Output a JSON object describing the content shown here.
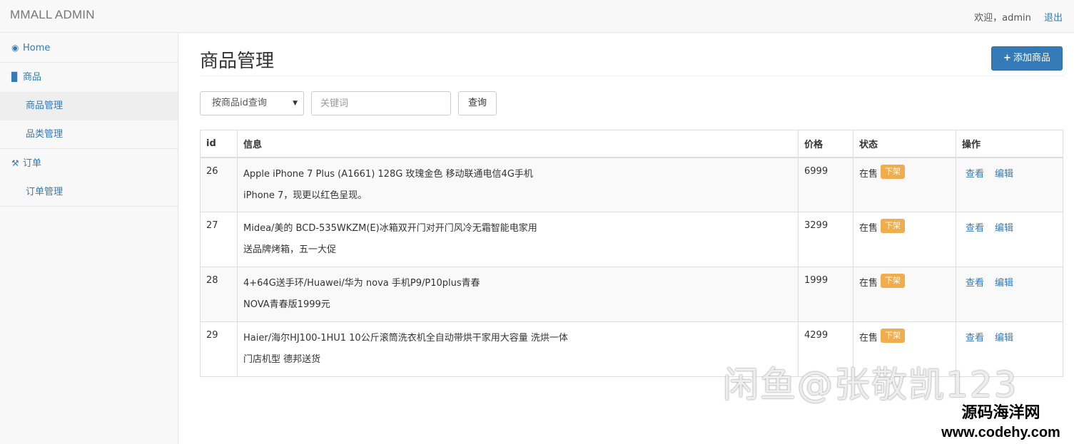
{
  "app": {
    "brand": "MMALL ADMIN"
  },
  "header": {
    "welcome": "欢迎，admin",
    "logout": "退出"
  },
  "sidebar": {
    "items": [
      {
        "label": "Home",
        "icon": "dashboard-icon"
      },
      {
        "label": "商品",
        "icon": "bar-chart-icon"
      },
      {
        "label": "商品管理"
      },
      {
        "label": "品类管理"
      },
      {
        "label": "订单",
        "icon": "wrench-icon"
      },
      {
        "label": "订单管理"
      }
    ]
  },
  "main": {
    "title": "商品管理",
    "add_button": "添加商品",
    "search": {
      "select_value": "按商品id查询",
      "placeholder": "关键词",
      "button": "查询"
    },
    "table": {
      "headers": [
        "id",
        "信息",
        "价格",
        "状态",
        "操作"
      ],
      "rows": [
        {
          "id": "26",
          "name": "Apple iPhone 7 Plus (A1661) 128G 玫瑰金色 移动联通电信4G手机",
          "subtitle": "iPhone 7，现更以红色呈现。",
          "price": "6999",
          "status": "在售",
          "status_action": "下架",
          "view": "查看",
          "edit": "编辑"
        },
        {
          "id": "27",
          "name": "Midea/美的 BCD-535WKZM(E)冰箱双开门对开门风冷无霜智能电家用",
          "subtitle": "送品牌烤箱，五一大促",
          "price": "3299",
          "status": "在售",
          "status_action": "下架",
          "view": "查看",
          "edit": "编辑"
        },
        {
          "id": "28",
          "name": "4+64G送手环/Huawei/华为 nova 手机P9/P10plus青春",
          "subtitle": "NOVA青春版1999元",
          "price": "1999",
          "status": "在售",
          "status_action": "下架",
          "view": "查看",
          "edit": "编辑"
        },
        {
          "id": "29",
          "name": "Haier/海尔HJ100-1HU1 10公斤滚筒洗衣机全自动带烘干家用大容量 洗烘一体",
          "subtitle": "门店机型 德邦送货",
          "price": "4299",
          "status": "在售",
          "status_action": "下架",
          "view": "查看",
          "edit": "编辑"
        }
      ]
    }
  },
  "overlay": {
    "watermark": "闲鱼@张敬凯123",
    "site_name": "源码海洋网",
    "site_url": "www.codehy.com"
  },
  "colors": {
    "link": "#337ab7",
    "primary": "#337ab7",
    "warning": "#f0ad4e"
  }
}
